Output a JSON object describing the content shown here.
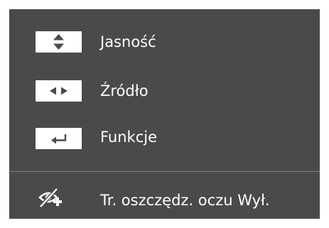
{
  "menu": {
    "items": [
      {
        "label": "Jasność",
        "icon": "up-down-arrows-icon"
      },
      {
        "label": "Źródło",
        "icon": "left-right-arrows-icon"
      },
      {
        "label": "Funkcje",
        "icon": "enter-return-icon"
      }
    ],
    "status": {
      "label": "Tr. oszczędz. oczu Wył.",
      "icon": "eye-saver-off-icon"
    }
  },
  "colors": {
    "panel": "#4a4a4a",
    "text": "#ffffff",
    "key_background": "#ffffff",
    "key_glyph": "#4a4a4a",
    "divider": "#7c7c7c"
  }
}
